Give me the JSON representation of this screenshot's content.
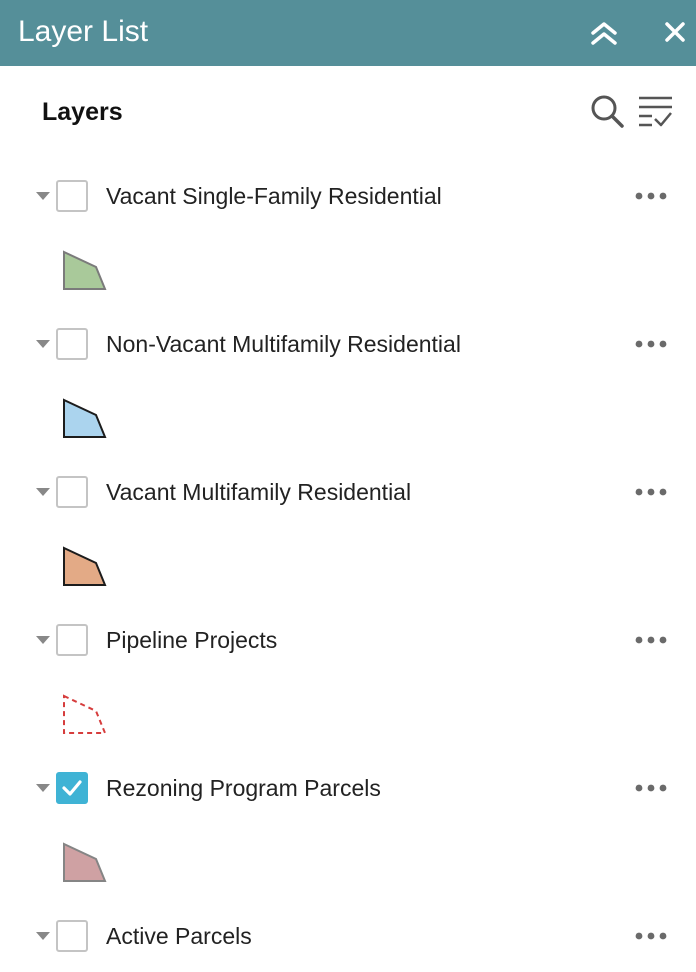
{
  "header": {
    "title": "Layer List",
    "color": "#558f99"
  },
  "toolbar": {
    "title": "Layers",
    "search_icon": "search-icon",
    "filter_icon": "filter-list-icon"
  },
  "layers": [
    {
      "label": "Vacant Single-Family Residential",
      "checked": false,
      "symbol_fill": "#a9c99a",
      "symbol_stroke": "#7b7b7b",
      "symbol_style": "solid"
    },
    {
      "label": "Non-Vacant Multifamily Residential",
      "checked": false,
      "symbol_fill": "#abd4ee",
      "symbol_stroke": "#1c1c1c",
      "symbol_style": "solid"
    },
    {
      "label": "Vacant Multifamily Residential",
      "checked": false,
      "symbol_fill": "#e3aa86",
      "symbol_stroke": "#1c1c1c",
      "symbol_style": "solid"
    },
    {
      "label": "Pipeline Projects",
      "checked": false,
      "symbol_fill": "none",
      "symbol_stroke": "#d63d3d",
      "symbol_style": "dashed"
    },
    {
      "label": "Rezoning Program Parcels",
      "checked": true,
      "symbol_fill": "#cfa1a3",
      "symbol_stroke": "#858585",
      "symbol_style": "solid"
    },
    {
      "label": "Active Parcels",
      "checked": false
    }
  ]
}
